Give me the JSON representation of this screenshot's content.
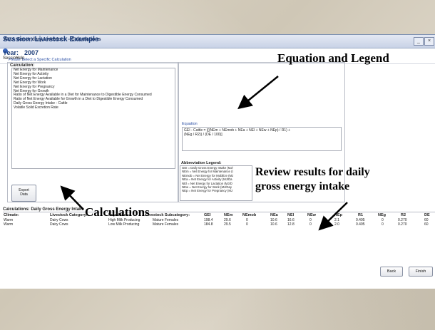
{
  "window": {
    "title": "ALU: Secondary Livestock - Calculations",
    "minimize": "_",
    "close": "×"
  },
  "menu": {
    "items": [
      "Session",
      "Help"
    ]
  },
  "session": {
    "label": "Session:",
    "name": "Livestock Example"
  },
  "year": {
    "label": "Year:",
    "value": "2007"
  },
  "prompt": "Please Select a Specific Calculation",
  "calculation": {
    "header": "Calculation:",
    "items": [
      "Net Energy for Maintenance",
      "Net Energy for Activity",
      "Net Energy for Lactation",
      "Net Energy for Work",
      "Net Energy for Pregnancy",
      "Net Energy for Growth",
      "Ratio of Net Energy Available in a Diet for Maintenance to Digestible Energy Consumed",
      "Ratio of Net Energy Available for Growth in a Diet to Digestible Energy Consumed",
      "Daily Gross Energy Intake - Cattle",
      "Volatile Solid Excretion Rate"
    ]
  },
  "export_button": {
    "line1": "Export",
    "line2": "Data"
  },
  "equation": {
    "label": "Equation",
    "line1": "GEI - Cattle = [((NEm + NEmob + NEa + NEl + NEw + NEp) / R1) +",
    "line2": "(NEg / R2)) / (DE / 100)]"
  },
  "abbreviation": {
    "label": "Abbreviation Legend:",
    "items": [
      "GEI = Daily Gross Energy Intake (MJ/",
      "NEm = Net Energy for Maintenance (I",
      "NEmob = Net Energy for Mobilize (MJ",
      "NEa = Net Energy for Activity (MJ/Da",
      "NEl = Net Energy for Lactation (MJ/D",
      "NEw = Net Energy for Work (MJ/Day",
      "NEp = Net Energy for Pregnancy (MJ"
    ]
  },
  "table": {
    "title": "Calculations: Daily Gross Energy Intake",
    "columns": [
      "Climate:",
      "Livestock Category:",
      "Population:",
      "Livestock Subcategory:",
      "GEI",
      "NEm",
      "NEmob",
      "NEa",
      "NEl",
      "NEw",
      "NEp",
      "R1",
      "NEg",
      "R2",
      "DE"
    ],
    "rows": [
      [
        "Warm",
        "Dairy Cows",
        "High Milk Producing",
        "Mature Females",
        "198.4",
        "29.6",
        "0",
        "10.6",
        "16.6",
        "0",
        "2.1",
        "0.495",
        "0",
        "0.270",
        "60"
      ],
      [
        "Warm",
        "Dairy Cows",
        "Low Milk Producing",
        "Mature Females",
        "184.8",
        "29.5",
        "0",
        "10.6",
        "12.8",
        "0",
        "2.0",
        "0.495",
        "0",
        "0.270",
        "60"
      ]
    ]
  },
  "nav": {
    "back": "Back",
    "finish": "Finish"
  },
  "annotations": {
    "equation": "Equation and Legend",
    "review_line1": "Review results for daily",
    "review_line2": "gross energy intake",
    "calculations": "Calculations"
  }
}
